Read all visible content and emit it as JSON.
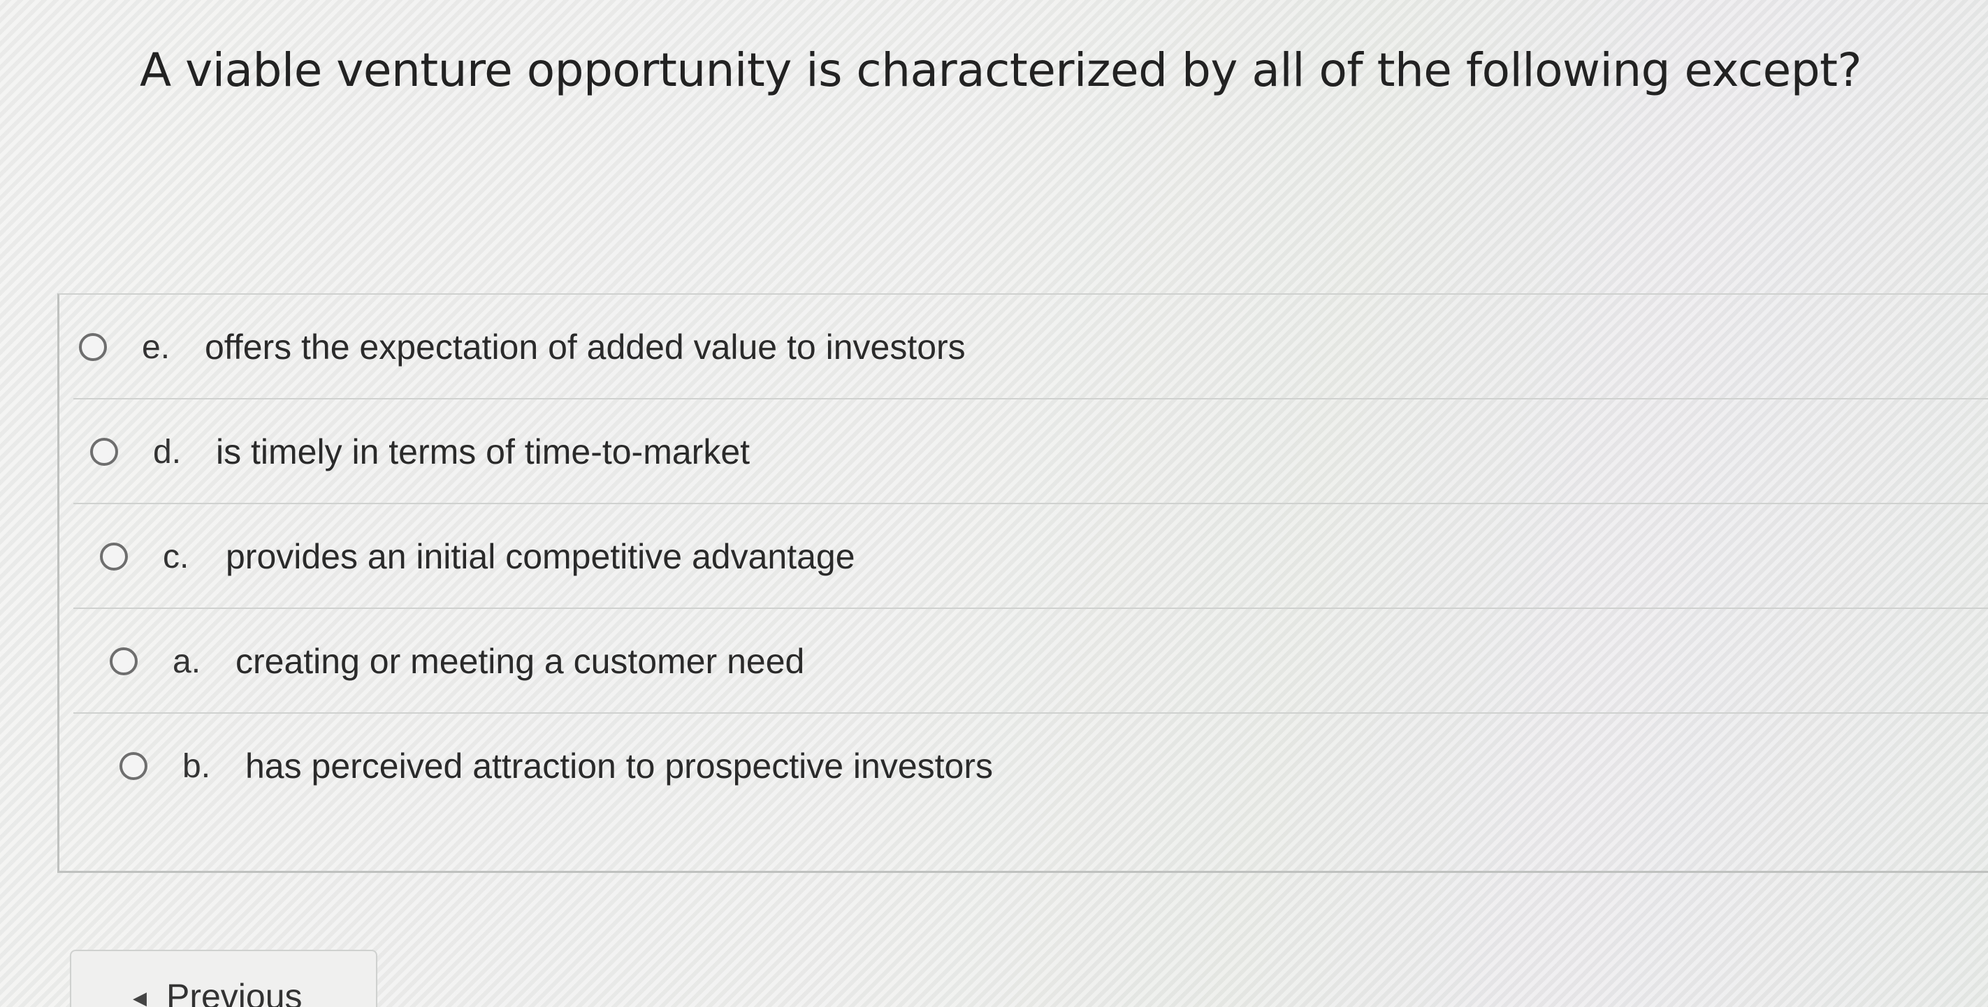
{
  "question": {
    "text": "A viable venture opportunity is characterized by all of the following except?"
  },
  "options": [
    {
      "letter": "e.",
      "text": "offers the expectation of added value to investors"
    },
    {
      "letter": "d.",
      "text": "is timely in terms of time-to-market"
    },
    {
      "letter": "c.",
      "text": "provides an initial competitive advantage"
    },
    {
      "letter": "a.",
      "text": "creating or meeting a customer need"
    },
    {
      "letter": "b.",
      "text": "has perceived attraction to prospective investors"
    }
  ],
  "navigation": {
    "previous_label": "Previous",
    "previous_icon": "caret-left-icon"
  }
}
